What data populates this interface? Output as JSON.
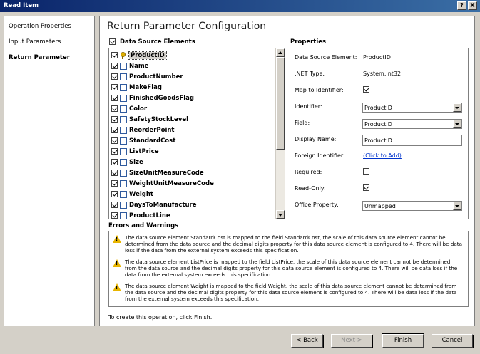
{
  "window": {
    "title": "Read Item",
    "help_label": "?",
    "close_label": "X"
  },
  "nav": {
    "items": [
      {
        "label": "Operation Properties"
      },
      {
        "label": "Input Parameters"
      },
      {
        "label": "Return Parameter"
      }
    ],
    "selected": "Return Parameter"
  },
  "page": {
    "heading": "Return Parameter Configuration"
  },
  "elements": {
    "header": "Data Source Elements",
    "header_checked": true,
    "items": [
      {
        "label": "ProductID",
        "checked": true,
        "icon": "key-icon"
      },
      {
        "label": "Name",
        "checked": true,
        "icon": "column-icon"
      },
      {
        "label": "ProductNumber",
        "checked": true,
        "icon": "column-icon"
      },
      {
        "label": "MakeFlag",
        "checked": true,
        "icon": "column-icon"
      },
      {
        "label": "FinishedGoodsFlag",
        "checked": true,
        "icon": "column-icon"
      },
      {
        "label": "Color",
        "checked": true,
        "icon": "column-icon"
      },
      {
        "label": "SafetyStockLevel",
        "checked": true,
        "icon": "column-icon"
      },
      {
        "label": "ReorderPoint",
        "checked": true,
        "icon": "column-icon"
      },
      {
        "label": "StandardCost",
        "checked": true,
        "icon": "column-icon"
      },
      {
        "label": "ListPrice",
        "checked": true,
        "icon": "column-icon"
      },
      {
        "label": "Size",
        "checked": true,
        "icon": "column-icon"
      },
      {
        "label": "SizeUnitMeasureCode",
        "checked": true,
        "icon": "column-icon"
      },
      {
        "label": "WeightUnitMeasureCode",
        "checked": true,
        "icon": "column-icon"
      },
      {
        "label": "Weight",
        "checked": true,
        "icon": "column-icon"
      },
      {
        "label": "DaysToManufacture",
        "checked": true,
        "icon": "column-icon"
      },
      {
        "label": "ProductLine",
        "checked": true,
        "icon": "column-icon"
      }
    ]
  },
  "properties": {
    "header": "Properties",
    "data_source_element_label": "Data Source Element:",
    "data_source_element_value": "ProductID",
    "net_type_label": ".NET Type:",
    "net_type_value": "System.Int32",
    "map_to_identifier_label": "Map to Identifier:",
    "map_to_identifier_checked": true,
    "identifier_label": "Identifier:",
    "identifier_value": "ProductID",
    "field_label": "Field:",
    "field_value": "ProductID",
    "display_name_label": "Display Name:",
    "display_name_value": "ProductID",
    "foreign_identifier_label": "Foreign Identifier:",
    "foreign_identifier_link": "(Click to Add)",
    "required_label": "Required:",
    "required_checked": false,
    "read_only_label": "Read-Only:",
    "read_only_checked": true,
    "office_property_label": "Office Property:",
    "office_property_value": "Unmapped"
  },
  "errors": {
    "header": "Errors and Warnings",
    "warnings": [
      "The data source element StandardCost is mapped to the field StandardCost, the scale of this data source element cannot be determined from the data source and the decimal digits property for this data source element is configured to 4. There will be data loss if the data from the external system exceeds this specification.",
      "The data source element ListPrice is mapped to the field ListPrice, the scale of this data source element cannot be determined from the data source and the decimal digits property for this data source element is configured to 4. There will be data loss if the data from the external system exceeds this specification.",
      "The data source element Weight is mapped to the field Weight, the scale of this data source element cannot be determined from the data source and the decimal digits property for this data source element is configured to 4. There will be data loss if the data from the external system exceeds this specification."
    ]
  },
  "footer_note": "To create this operation, click Finish.",
  "buttons": {
    "back": "< Back",
    "next": "Next >",
    "finish": "Finish",
    "cancel": "Cancel"
  }
}
